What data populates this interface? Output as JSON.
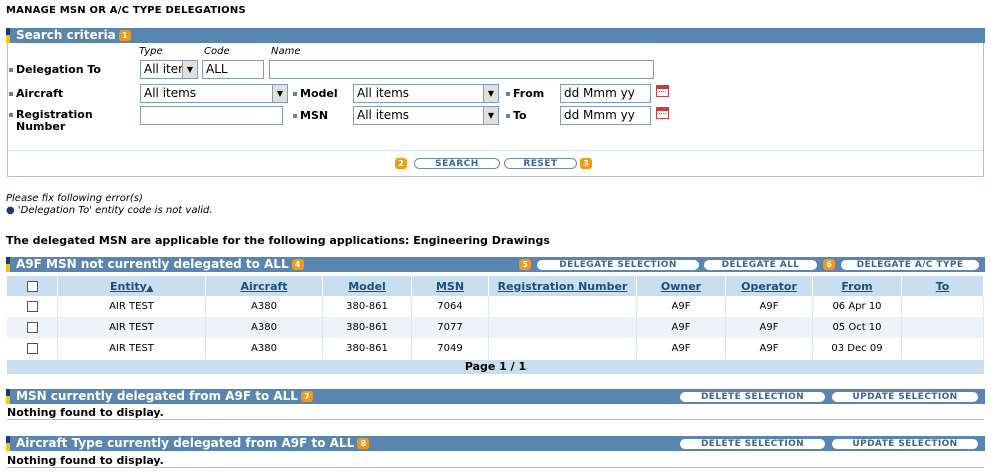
{
  "page_title": "MANAGE MSN OR A/C TYPE DELEGATIONS",
  "search": {
    "header": "Search criteria",
    "header_badge": "1",
    "col_type": "Type",
    "col_code": "Code",
    "col_name": "Name",
    "delegation_to_label": "Delegation To",
    "type_value": "All iter",
    "code_value": "ALL",
    "name_value": "",
    "aircraft_label": "Aircraft",
    "aircraft_value": "All items",
    "model_label": "Model",
    "model_value": "All items",
    "from_label": "From",
    "from_value": "dd Mmm yy",
    "registration_label_1": "Registration",
    "registration_label_2": "Number",
    "registration_value": "",
    "msn_label": "MSN",
    "msn_value": "All items",
    "to_label": "To",
    "to_value": "dd Mmm yy",
    "search_badge": "2",
    "search_button": "SEARCH",
    "reset_button": "RESET",
    "reset_badge": "3"
  },
  "errors": {
    "heading": "Please fix following error(s)",
    "items": [
      "'Delegation To' entity code is not valid."
    ]
  },
  "applicability_text": "The delegated MSN are applicable for the following applications: Engineering Drawings",
  "not_delegated": {
    "header": "A9F MSN not currently delegated to ALL",
    "badge": "4",
    "delegate_selection_badge": "5",
    "delegate_selection": "DELEGATE SELECTION",
    "delegate_all": "DELEGATE ALL",
    "delegate_type_badge": "6",
    "delegate_type": "DELEGATE A/C TYPE",
    "columns": [
      "Entity",
      "Aircraft",
      "Model",
      "MSN",
      "Registration Number",
      "Owner",
      "Operator",
      "From",
      "To"
    ],
    "sort_indicator": "▲",
    "rows": [
      {
        "entity": "AIR TEST",
        "aircraft": "A380",
        "model": "380-861",
        "msn": "7064",
        "registration": "",
        "owner": "A9F",
        "operator": "A9F",
        "from": "06 Apr 10",
        "to": ""
      },
      {
        "entity": "AIR TEST",
        "aircraft": "A380",
        "model": "380-861",
        "msn": "7077",
        "registration": "",
        "owner": "A9F",
        "operator": "A9F",
        "from": "05 Oct 10",
        "to": ""
      },
      {
        "entity": "AIR TEST",
        "aircraft": "A380",
        "model": "380-861",
        "msn": "7049",
        "registration": "",
        "owner": "A9F",
        "operator": "A9F",
        "from": "03 Dec 09",
        "to": ""
      }
    ],
    "pager": "Page 1 / 1"
  },
  "msn_delegated": {
    "header": "MSN currently delegated from A9F to ALL",
    "badge": "7",
    "delete_selection": "DELETE SELECTION",
    "update_selection": "UPDATE SELECTION",
    "empty": "Nothing found to display."
  },
  "type_delegated": {
    "header": "Aircraft Type currently delegated from A9F to ALL",
    "badge": "8",
    "delete_selection": "DELETE SELECTION",
    "update_selection": "UPDATE SELECTION",
    "empty": "Nothing found to display."
  },
  "colors": {
    "bar": "#5985AE",
    "table_header": "#C9DFEF",
    "badge": "#F19A19",
    "link": "#1D4E80"
  }
}
